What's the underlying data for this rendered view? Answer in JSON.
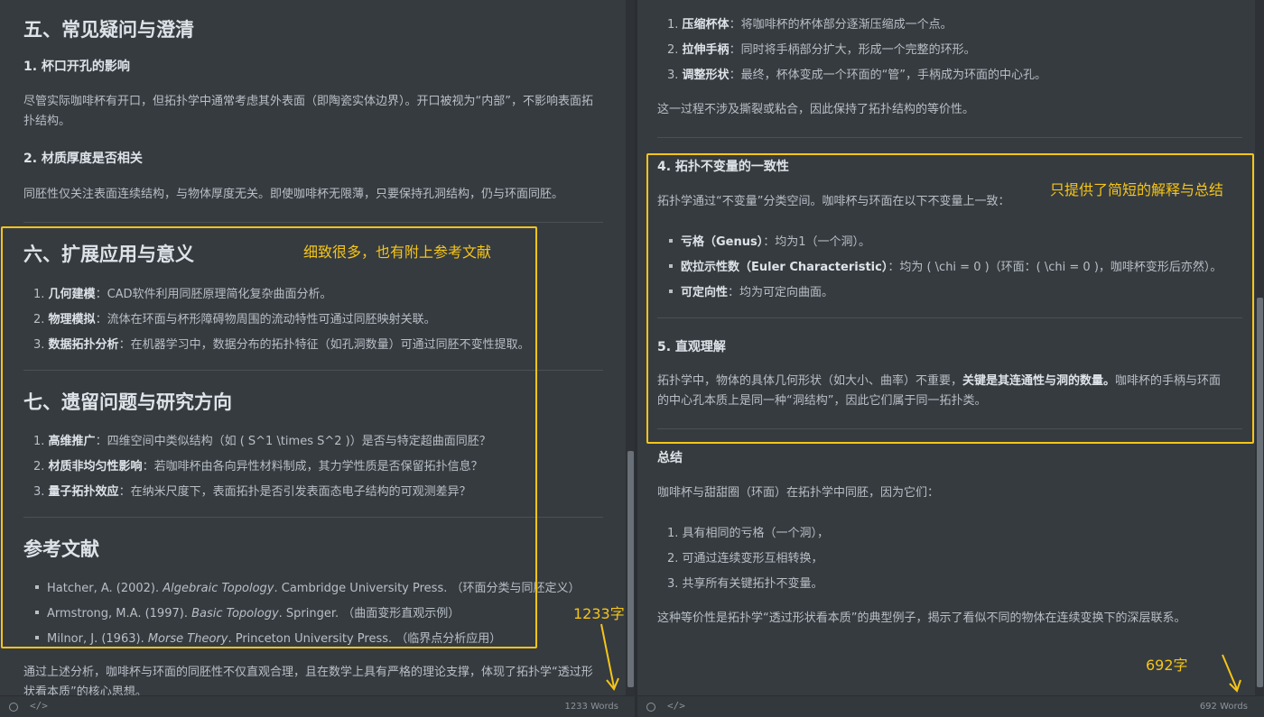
{
  "left": {
    "section5": {
      "title": "五、常见疑问与澄清",
      "q1_title": "1. 杯口开孔的影响",
      "q1_text_l1": "尽管实际咖啡杯有开口，但拓扑学中通常考虑其外表面（即陶瓷实体边界）。开口被视为“内部”，不影响表面拓",
      "q1_text_l2": "扑结构。",
      "q2_title": "2. 材质厚度是否相关",
      "q2_text": "同胚性仅关注表面连续结构，与物体厚度无关。即使咖啡杯无限薄，只要保持孔洞结构，仍与环面同胚。"
    },
    "section6": {
      "title": "六、扩展应用与意义",
      "items": [
        {
          "num": "1.",
          "bold": "几何建模",
          "text": "：CAD软件利用同胚原理简化复杂曲面分析。"
        },
        {
          "num": "2.",
          "bold": "物理模拟",
          "text": "：流体在环面与杯形障碍物周围的流动特性可通过同胚映射关联。"
        },
        {
          "num": "3.",
          "bold": "数据拓扑分析",
          "text": "：在机器学习中，数据分布的拓扑特征（如孔洞数量）可通过同胚不变性提取。"
        }
      ]
    },
    "section7": {
      "title": "七、遗留问题与研究方向",
      "items": [
        {
          "num": "1.",
          "bold": "高维推广",
          "text": "：四维空间中类似结构（如 ( S^1 \\times S^2 )）是否与特定超曲面同胚？"
        },
        {
          "num": "2.",
          "bold": "材质非均匀性影响",
          "text": "：若咖啡杯由各向异性材料制成，其力学性质是否保留拓扑信息？"
        },
        {
          "num": "3.",
          "bold": "量子拓扑效应",
          "text": "：在纳米尺度下，表面拓扑是否引发表面态电子结构的可观测差异？"
        }
      ]
    },
    "references": {
      "title": "参考文献",
      "items": [
        {
          "pre": "Hatcher, A. (2002). ",
          "italic": "Algebraic Topology",
          "post": ". Cambridge University Press. （环面分类与同胚定义）"
        },
        {
          "pre": "Armstrong, M.A. (1997). ",
          "italic": "Basic Topology",
          "post": ". Springer. （曲面变形直观示例）"
        },
        {
          "pre": "Milnor, J. (1963). ",
          "italic": "Morse Theory",
          "post": ". Princeton University Press. （临界点分析应用）"
        }
      ]
    },
    "closing_l1": "通过上述分析，咖啡杯与环面的同胚性不仅直观合理，且在数学上具有严格的理论支撑，体现了拓扑学“透过形",
    "closing_l2": "状看本质”的核心思想。",
    "annotation": "细致很多，也有附上参考文献",
    "count_annotation": "1233字",
    "status_words": "1233 Words",
    "status_code": "</>"
  },
  "right": {
    "steps": [
      {
        "num": "1.",
        "bold": "压缩杯体",
        "text": "：将咖啡杯的杯体部分逐渐压缩成一个点。"
      },
      {
        "num": "2.",
        "bold": "拉伸手柄",
        "text": "：同时将手柄部分扩大，形成一个完整的环形。"
      },
      {
        "num": "3.",
        "bold": "调整形状",
        "text": "：最终，杯体变成一个环面的“管”，手柄成为环面的中心孔。"
      }
    ],
    "steps_note": "这一过程不涉及撕裂或粘合，因此保持了拓扑结构的等价性。",
    "section4": {
      "title": "4. 拓扑不变量的一致性",
      "intro": "拓扑学通过“不变量”分类空间。咖啡杯与环面在以下不变量上一致：",
      "items": [
        {
          "bold": "亏格（Genus）",
          "text": "：均为1（一个洞）。"
        },
        {
          "bold": "欧拉示性数（Euler Characteristic）",
          "text": "：均为 ( \\chi = 0 )（环面：( \\chi = 0 )，咖啡杯变形后亦然）。"
        },
        {
          "bold": "可定向性",
          "text": "：均为可定向曲面。"
        }
      ]
    },
    "section5": {
      "title": "5. 直观理解",
      "l1_pre": "拓扑学中，物体的具体几何形状（如大小、曲率）不重要，",
      "l1_bold": "关键是其连通性与洞的数量。",
      "l1_post": "咖啡杯的手柄与环面",
      "l2": "的中心孔本质上是同一种“洞结构”，因此它们属于同一拓扑类。"
    },
    "summary": {
      "title": "总结",
      "intro": "咖啡杯与甜甜圈（环面）在拓扑学中同胚，因为它们：",
      "items": [
        {
          "num": "1.",
          "text": "具有相同的亏格（一个洞），"
        },
        {
          "num": "2.",
          "text": "可通过连续变形互相转换，"
        },
        {
          "num": "3.",
          "text": "共享所有关键拓扑不变量。"
        }
      ],
      "closing": "这种等价性是拓扑学“透过形状看本质”的典型例子，揭示了看似不同的物体在连续变换下的深层联系。"
    },
    "annotation": "只提供了简短的解释与总结",
    "count_annotation": "692字",
    "status_words": "692 Words",
    "status_code": "</>"
  },
  "colors": {
    "annotation": "#f5c518",
    "background": "#363b40",
    "heading": "#dde3e8",
    "text": "#b8bfc6"
  }
}
